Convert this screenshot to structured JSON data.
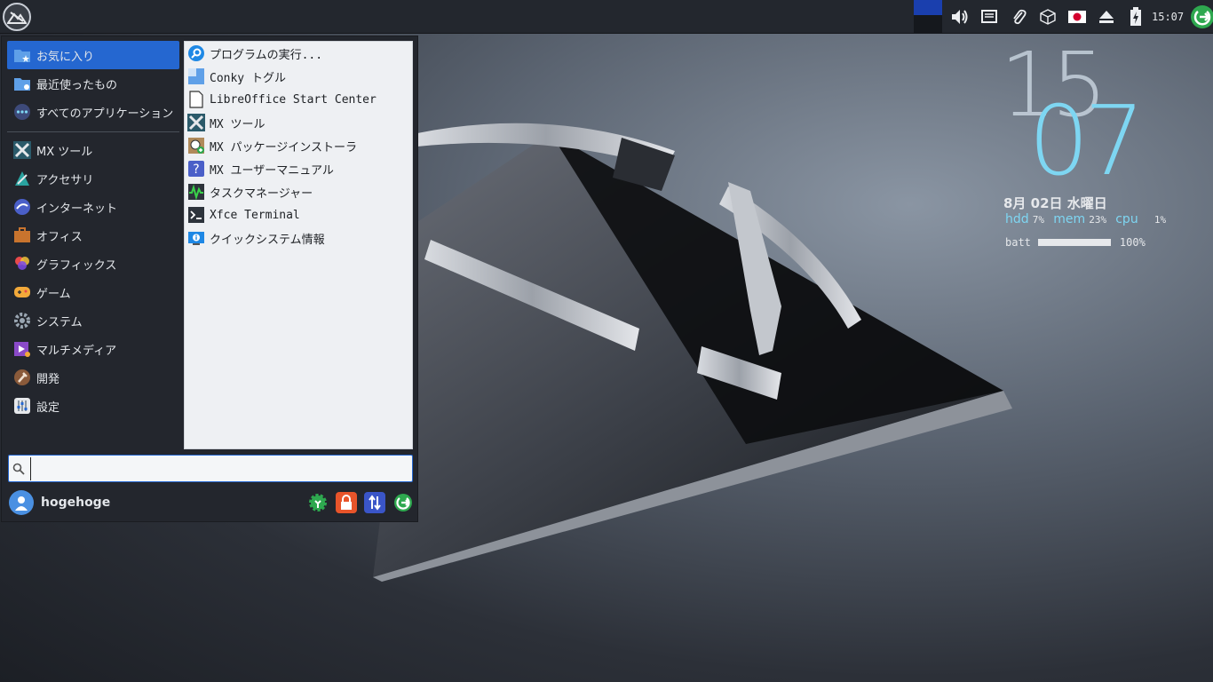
{
  "panel": {
    "clock": "15:07",
    "tray_icons": [
      "volume-icon",
      "network-icon",
      "clipboard-icon",
      "package-icon",
      "keyboard-layout-icon",
      "eject-icon",
      "battery-icon",
      "power-icon"
    ]
  },
  "conky": {
    "hour": "15",
    "minute": "07",
    "date": "8月 02日 水曜日",
    "hdd_label": "hdd",
    "hdd_value": "7%",
    "mem_label": "mem",
    "mem_value": "23%",
    "cpu_label": "cpu",
    "cpu_value": "1%",
    "batt_label": "batt",
    "batt_value": "100%",
    "batt_level": 1.0
  },
  "menu": {
    "categories": [
      {
        "label": "お気に入り",
        "icon": "favorites-folder-icon",
        "active": true
      },
      {
        "label": "最近使ったもの",
        "icon": "recent-folder-icon"
      },
      {
        "label": "すべてのアプリケーション",
        "icon": "all-apps-icon"
      },
      {
        "label": "MX ツール",
        "icon": "mx-tools-icon"
      },
      {
        "label": "アクセサリ",
        "icon": "accessories-icon"
      },
      {
        "label": "インターネット",
        "icon": "internet-icon"
      },
      {
        "label": "オフィス",
        "icon": "office-icon"
      },
      {
        "label": "グラフィックス",
        "icon": "graphics-icon"
      },
      {
        "label": "ゲーム",
        "icon": "games-icon"
      },
      {
        "label": "システム",
        "icon": "system-icon"
      },
      {
        "label": "マルチメディア",
        "icon": "multimedia-icon"
      },
      {
        "label": "開発",
        "icon": "development-icon"
      },
      {
        "label": "設定",
        "icon": "settings-icon"
      }
    ],
    "apps": [
      {
        "label": "プログラムの実行...",
        "icon": "run-program-icon"
      },
      {
        "label": "Conky トグル",
        "icon": "conky-toggle-icon"
      },
      {
        "label": "LibreOffice Start Center",
        "icon": "libreoffice-icon"
      },
      {
        "label": "MX ツール",
        "icon": "mx-tools-icon"
      },
      {
        "label": "MX パッケージインストーラ",
        "icon": "package-installer-icon"
      },
      {
        "label": "MX ユーザーマニュアル",
        "icon": "user-manual-icon"
      },
      {
        "label": "タスクマネージャー",
        "icon": "task-manager-icon"
      },
      {
        "label": "Xfce Terminal",
        "icon": "terminal-icon"
      },
      {
        "label": "クイックシステム情報",
        "icon": "system-info-icon"
      }
    ],
    "search": {
      "value": "",
      "placeholder": ""
    },
    "user": {
      "name": "hogehoge"
    },
    "actions": [
      "settings-manager-icon",
      "lock-screen-icon",
      "switch-user-icon",
      "logout-icon"
    ]
  },
  "colors": {
    "accent": "#2567d0",
    "conky_cyan": "#7ed6f2",
    "panel": "#23272e"
  }
}
